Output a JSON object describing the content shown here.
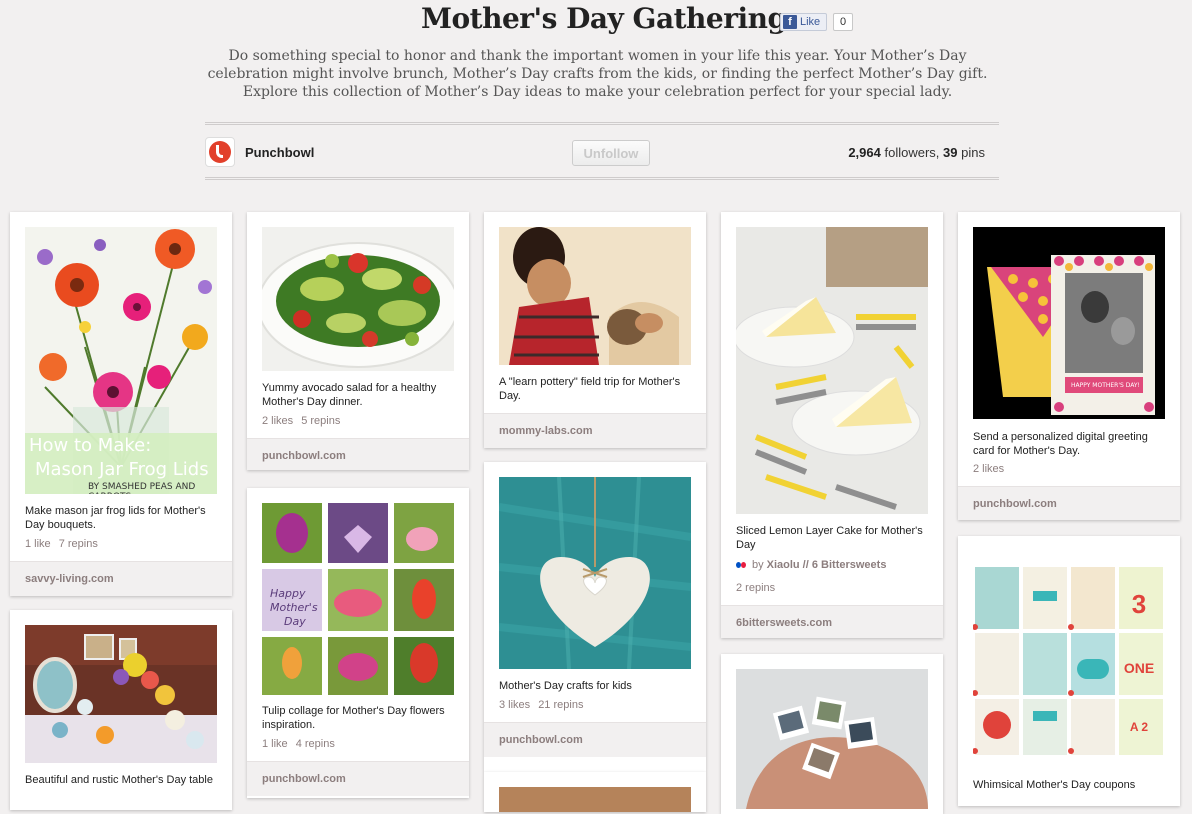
{
  "board": {
    "title": "Mother's Day Gatherings",
    "like_label": "Like",
    "like_count": "0",
    "description": "Do something special to honor and thank the important women in your life this year. Your Mother’s Day celebration might involve brunch, Mother’s Day crafts from the kids, or finding the perfect Mother’s Day gift. Explore this collection of Mother’s Day ideas to make your celebration perfect for your special lady.",
    "owner": "Punchbowl",
    "unfollow_label": "Unfollow",
    "followers_count": "2,964",
    "followers_label": "followers,",
    "pins_count": "39",
    "pins_label": "pins"
  },
  "pins": [
    {
      "desc": "Make mason jar frog lids for Mother's Day bouquets.",
      "likes": "1 like",
      "repins": "7 repins",
      "source": "savvy-living.com",
      "overlay_line1": "How to Make:",
      "overlay_line2": "Mason Jar Frog Lids",
      "overlay_line3": "BY SMASHED PEAS AND CARROTS"
    },
    {
      "desc": "Yummy avocado salad for a healthy Mother's Day dinner.",
      "likes": "2 likes",
      "repins": "5 repins",
      "source": "punchbowl.com"
    },
    {
      "desc": "A \"learn pottery\" field trip for Mother's Day.",
      "source": "mommy-labs.com"
    },
    {
      "desc": "Sliced Lemon Layer Cake for Mother's Day",
      "by_label": "by",
      "by_user": "Xiaolu // 6 Bittersweets",
      "repins": "2 repins",
      "source": "6bittersweets.com"
    },
    {
      "desc": "Send a personalized digital greeting card for Mother's Day.",
      "likes": "2 likes",
      "source": "punchbowl.com",
      "card_text": "HAPPY MOTHER'S DAY!"
    },
    {
      "desc": "Beautiful and rustic Mother's Day table"
    },
    {
      "desc": "Tulip collage for Mother's Day flowers inspiration.",
      "likes": "1 like",
      "repins": "4 repins",
      "source": "punchbowl.com",
      "overlay_line1": "Happy",
      "overlay_line2": "Mother's",
      "overlay_line3": "Day"
    },
    {
      "desc": "Mother's Day crafts for kids",
      "likes": "3 likes",
      "repins": "21 repins",
      "source": "punchbowl.com"
    },
    {
      "desc": ""
    },
    {
      "desc": "Whimsical Mother's Day coupons"
    }
  ],
  "colors": {
    "accent": "#e2402b",
    "facebook": "#3b5998",
    "background": "#f2f0f0",
    "source_text": "#8c7e7e"
  }
}
